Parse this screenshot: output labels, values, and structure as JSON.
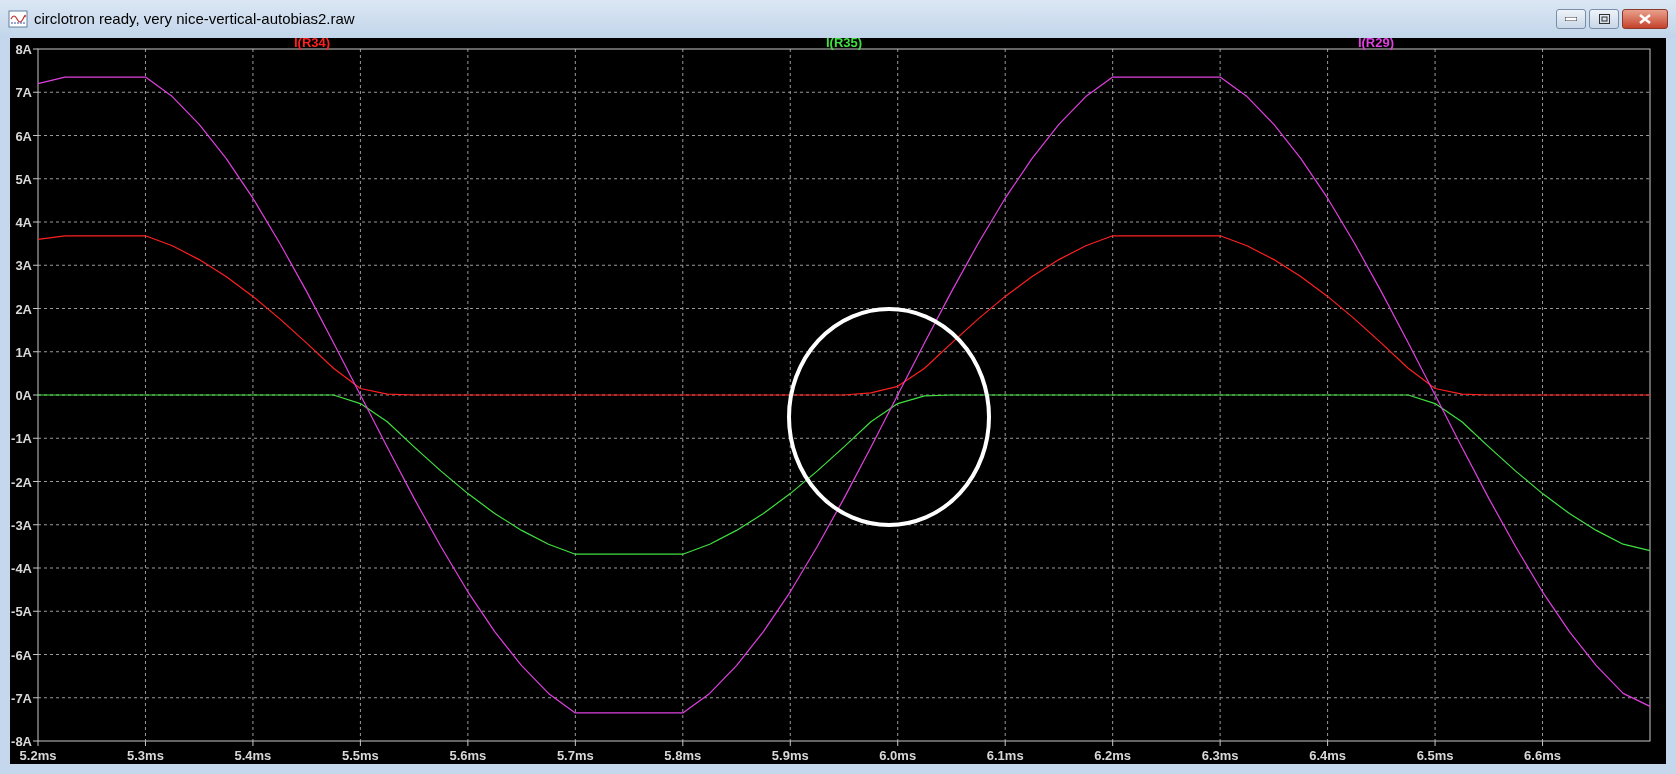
{
  "window": {
    "title": "circlotron ready, very nice-vertical-autobias2.raw",
    "buttons": [
      {
        "kind": "minimize"
      },
      {
        "kind": "maximize"
      },
      {
        "kind": "close"
      }
    ]
  },
  "plot": {
    "chart_data": {
      "type": "line",
      "x": [
        5.2,
        5.225,
        5.25,
        5.275,
        5.3,
        5.325,
        5.35,
        5.375,
        5.4,
        5.425,
        5.45,
        5.475,
        5.5,
        5.525,
        5.55,
        5.575,
        5.6,
        5.625,
        5.65,
        5.675,
        5.7,
        5.725,
        5.75,
        5.775,
        5.8,
        5.825,
        5.85,
        5.875,
        5.9,
        5.925,
        5.95,
        5.975,
        6.0,
        6.025,
        6.05,
        6.075,
        6.1,
        6.125,
        6.15,
        6.175,
        6.2,
        6.225,
        6.25,
        6.275,
        6.3,
        6.325,
        6.35,
        6.375,
        6.4,
        6.425,
        6.45,
        6.475,
        6.5,
        6.525,
        6.55,
        6.575,
        6.6,
        6.625,
        6.65,
        6.675,
        6.7
      ],
      "series": [
        {
          "name": "I(R34)",
          "color": "#ff2020",
          "values": [
            3.6,
            3.68,
            3.68,
            3.68,
            3.68,
            3.45,
            3.13,
            2.74,
            2.28,
            1.76,
            1.2,
            0.62,
            0.15,
            0.02,
            0,
            0,
            0,
            0,
            0,
            0,
            0,
            0,
            0,
            0,
            0,
            0,
            0,
            0,
            0,
            0,
            0,
            0.05,
            0.2,
            0.62,
            1.2,
            1.76,
            2.28,
            2.74,
            3.13,
            3.45,
            3.68,
            3.68,
            3.68,
            3.68,
            3.68,
            3.45,
            3.13,
            2.74,
            2.28,
            1.76,
            1.2,
            0.62,
            0.15,
            0.02,
            0,
            0,
            0,
            0,
            0,
            0,
            0
          ]
        },
        {
          "name": "I(R35)",
          "color": "#40e040",
          "values": [
            0,
            0,
            0,
            0,
            0,
            0,
            0,
            0,
            0,
            0,
            0,
            0,
            -0.2,
            -0.62,
            -1.2,
            -1.76,
            -2.28,
            -2.74,
            -3.13,
            -3.45,
            -3.68,
            -3.68,
            -3.68,
            -3.68,
            -3.68,
            -3.45,
            -3.13,
            -2.74,
            -2.28,
            -1.76,
            -1.2,
            -0.62,
            -0.2,
            -0.02,
            0,
            0,
            0,
            0,
            0,
            0,
            0,
            0,
            0,
            0,
            0,
            0,
            0,
            0,
            0,
            0,
            0,
            0,
            -0.2,
            -0.62,
            -1.2,
            -1.76,
            -2.28,
            -2.74,
            -3.13,
            -3.45,
            -3.6
          ]
        },
        {
          "name": "I(R29)",
          "color": "#e040e0",
          "values": [
            7.2,
            7.35,
            7.35,
            7.35,
            7.35,
            6.9,
            6.26,
            5.47,
            4.55,
            3.51,
            2.39,
            1.21,
            0,
            -1.21,
            -2.39,
            -3.51,
            -4.55,
            -5.47,
            -6.26,
            -6.9,
            -7.35,
            -7.35,
            -7.35,
            -7.35,
            -7.35,
            -6.9,
            -6.26,
            -5.47,
            -4.55,
            -3.51,
            -2.39,
            -1.21,
            0,
            1.21,
            2.39,
            3.51,
            4.55,
            5.47,
            6.26,
            6.9,
            7.35,
            7.35,
            7.35,
            7.35,
            7.35,
            6.9,
            6.26,
            5.47,
            4.55,
            3.51,
            2.39,
            1.21,
            0,
            -1.21,
            -2.39,
            -3.51,
            -4.55,
            -5.47,
            -6.26,
            -6.9,
            -7.2
          ]
        }
      ],
      "xlim": [
        5.2,
        6.7
      ],
      "ylim": [
        -8,
        8
      ],
      "xticks": [
        {
          "value": 5.2,
          "label": "5.2ms"
        },
        {
          "value": 5.3,
          "label": "5.3ms"
        },
        {
          "value": 5.4,
          "label": "5.4ms"
        },
        {
          "value": 5.5,
          "label": "5.5ms"
        },
        {
          "value": 5.6,
          "label": "5.6ms"
        },
        {
          "value": 5.7,
          "label": "5.7ms"
        },
        {
          "value": 5.8,
          "label": "5.8ms"
        },
        {
          "value": 5.9,
          "label": "5.9ms"
        },
        {
          "value": 6.0,
          "label": "6.0ms"
        },
        {
          "value": 6.1,
          "label": "6.1ms"
        },
        {
          "value": 6.2,
          "label": "6.2ms"
        },
        {
          "value": 6.3,
          "label": "6.3ms"
        },
        {
          "value": 6.4,
          "label": "6.4ms"
        },
        {
          "value": 6.5,
          "label": "6.5ms"
        },
        {
          "value": 6.6,
          "label": "6.6ms"
        }
      ],
      "yticks": [
        {
          "value": 8,
          "label": "8A"
        },
        {
          "value": 7,
          "label": "7A"
        },
        {
          "value": 6,
          "label": "6A"
        },
        {
          "value": 5,
          "label": "5A"
        },
        {
          "value": 4,
          "label": "4A"
        },
        {
          "value": 3,
          "label": "3A"
        },
        {
          "value": 2,
          "label": "2A"
        },
        {
          "value": 1,
          "label": "1A"
        },
        {
          "value": 0,
          "label": "0A"
        },
        {
          "value": -1,
          "label": "-1A"
        },
        {
          "value": -2,
          "label": "-2A"
        },
        {
          "value": -3,
          "label": "-3A"
        },
        {
          "value": -4,
          "label": "-4A"
        },
        {
          "value": -5,
          "label": "-5A"
        },
        {
          "value": -6,
          "label": "-6A"
        },
        {
          "value": -7,
          "label": "-7A"
        },
        {
          "value": -8,
          "label": "-8A"
        }
      ],
      "grid": true
    }
  }
}
